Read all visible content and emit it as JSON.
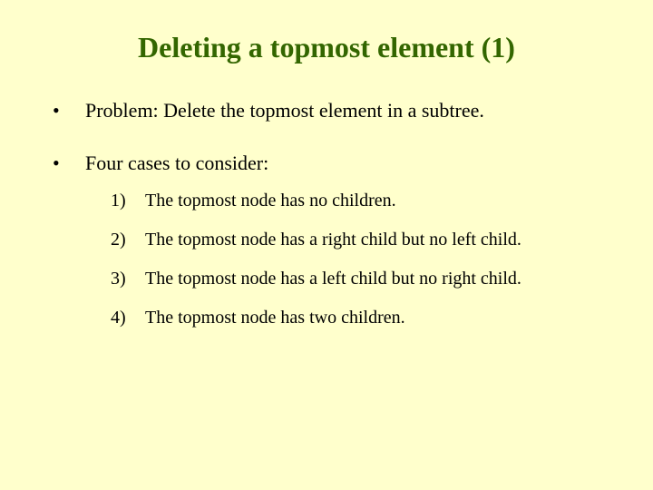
{
  "title": "Deleting a topmost element (1)",
  "bullets": [
    {
      "text": "Problem: Delete the topmost element in a subtree."
    },
    {
      "text": "Four cases to consider:",
      "sub": [
        "The topmost node has no children.",
        "The topmost node has a right child but no left child.",
        "The topmost node has a left child but no right child.",
        "The topmost node has two children."
      ]
    }
  ]
}
